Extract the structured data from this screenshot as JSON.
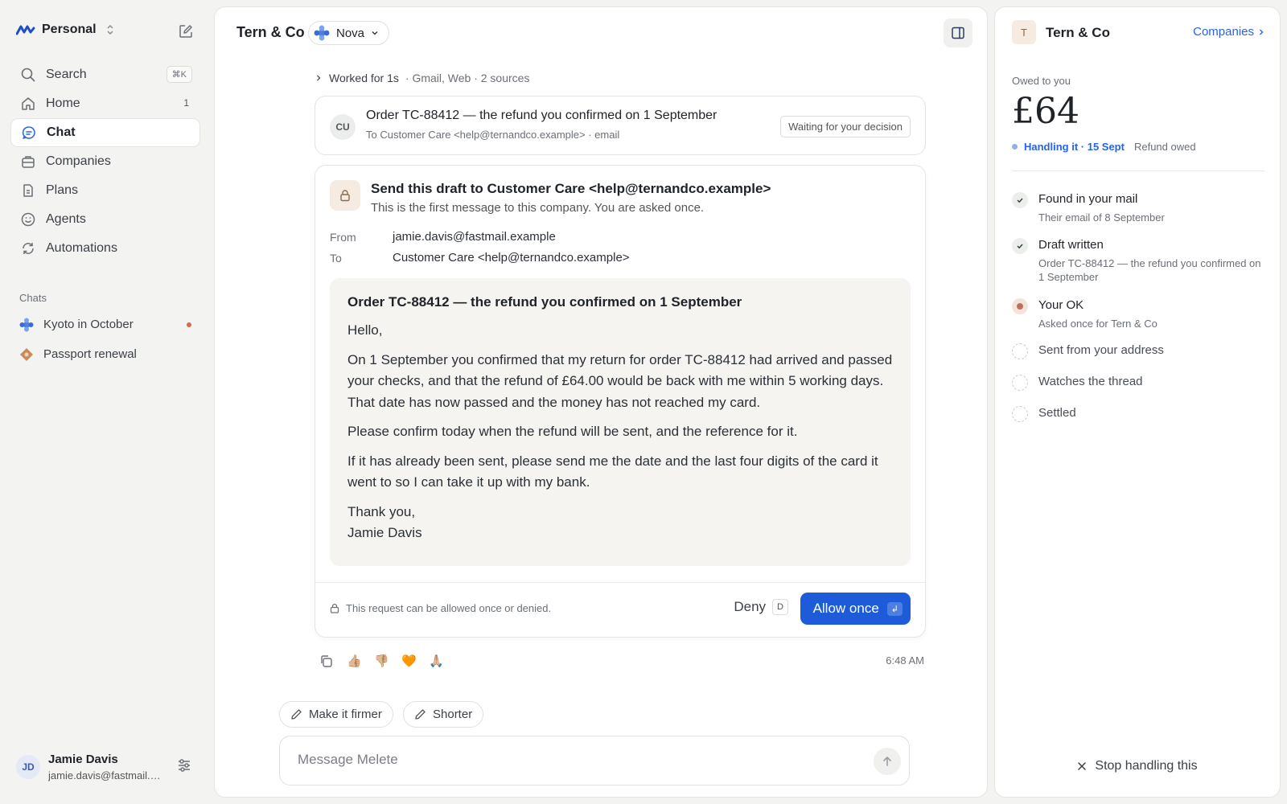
{
  "sidebar": {
    "workspace": "Personal",
    "search_shortcut": "⌘K",
    "nav": [
      {
        "label": "Search",
        "icon": "search-icon"
      },
      {
        "label": "Home",
        "icon": "home-icon",
        "badge": "1"
      },
      {
        "label": "Chat",
        "icon": "chat-icon",
        "active": true
      },
      {
        "label": "Companies",
        "icon": "briefcase-icon"
      },
      {
        "label": "Plans",
        "icon": "document-icon"
      },
      {
        "label": "Agents",
        "icon": "smiley-icon"
      },
      {
        "label": "Automations",
        "icon": "automation-icon"
      }
    ],
    "chats_label": "Chats",
    "chats": [
      {
        "label": "Kyoto in October",
        "unread": true
      },
      {
        "label": "Passport renewal",
        "unread": false
      }
    ],
    "user": {
      "initials": "JD",
      "name": "Jamie Davis",
      "email": "jamie.davis@fastmail.example"
    }
  },
  "main": {
    "title": "Tern & Co",
    "agent": "Nova",
    "worked": {
      "label": "Worked for 1s",
      "meta": "· Gmail, Web · 2 sources"
    },
    "order_card": {
      "avatar": "CU",
      "title": "Order TC-88412 — the refund you confirmed on 1 September",
      "sub": "To Customer Care <help@ternandco.example> · email",
      "status": "Waiting for your decision"
    },
    "draft": {
      "heading": "Send this draft to Customer Care <help@ternandco.example>",
      "sub": "This is the first message to this company. You are asked once.",
      "from_label": "From",
      "from_value": "jamie.davis@fastmail.example",
      "to_label": "To",
      "to_value": "Customer Care <help@ternandco.example>",
      "subject": "Order TC-88412 — the refund you confirmed on 1 September",
      "paragraphs": [
        "Hello,",
        "On 1 September you confirmed that my return for order TC-88412 had arrived and passed your checks, and that the refund of £64.00 would be back with me within 5 working days. That date has now passed and the money has not reached my card.",
        "Please confirm today when the refund will be sent, and the reference for it.",
        "If it has already been sent, please send me the date and the last four digits of the card it went to so I can take it up with my bank."
      ],
      "signoff_1": "Thank you,",
      "signoff_2": "Jamie Davis",
      "footnote": "This request can be allowed once or denied.",
      "deny_label": "Deny",
      "deny_key": "D",
      "allow_label": "Allow once",
      "allow_key": "↲"
    },
    "reactions": [
      "👍🏼",
      "👎🏼",
      "🧡",
      "🙏🏼"
    ],
    "timestamp": "6:48 AM",
    "suggestions": [
      "Make it firmer",
      "Shorter"
    ],
    "composer_placeholder": "Message Melete"
  },
  "right": {
    "avatar": "T",
    "title": "Tern & Co",
    "link": "Companies",
    "owed_label": "Owed to you",
    "owed_amount": "£64",
    "status_handling": "Handling it · 15 Sept",
    "status_note": "Refund owed",
    "steps": [
      {
        "title": "Found in your mail",
        "sub": "Their email of 8 September",
        "state": "done"
      },
      {
        "title": "Draft written",
        "sub": "Order TC-88412 — the refund you confirmed on 1 September",
        "state": "done"
      },
      {
        "title": "Your OK",
        "sub": "Asked once for Tern & Co",
        "state": "current"
      },
      {
        "title": "Sent from your address",
        "sub": "",
        "state": "todo"
      },
      {
        "title": "Watches the thread",
        "sub": "",
        "state": "todo"
      },
      {
        "title": "Settled",
        "sub": "",
        "state": "todo"
      }
    ],
    "stop_label": "Stop handling this"
  },
  "colors": {
    "accent": "#1d5bd8",
    "link": "#2563eb",
    "pending_dot": "#c0705a"
  }
}
